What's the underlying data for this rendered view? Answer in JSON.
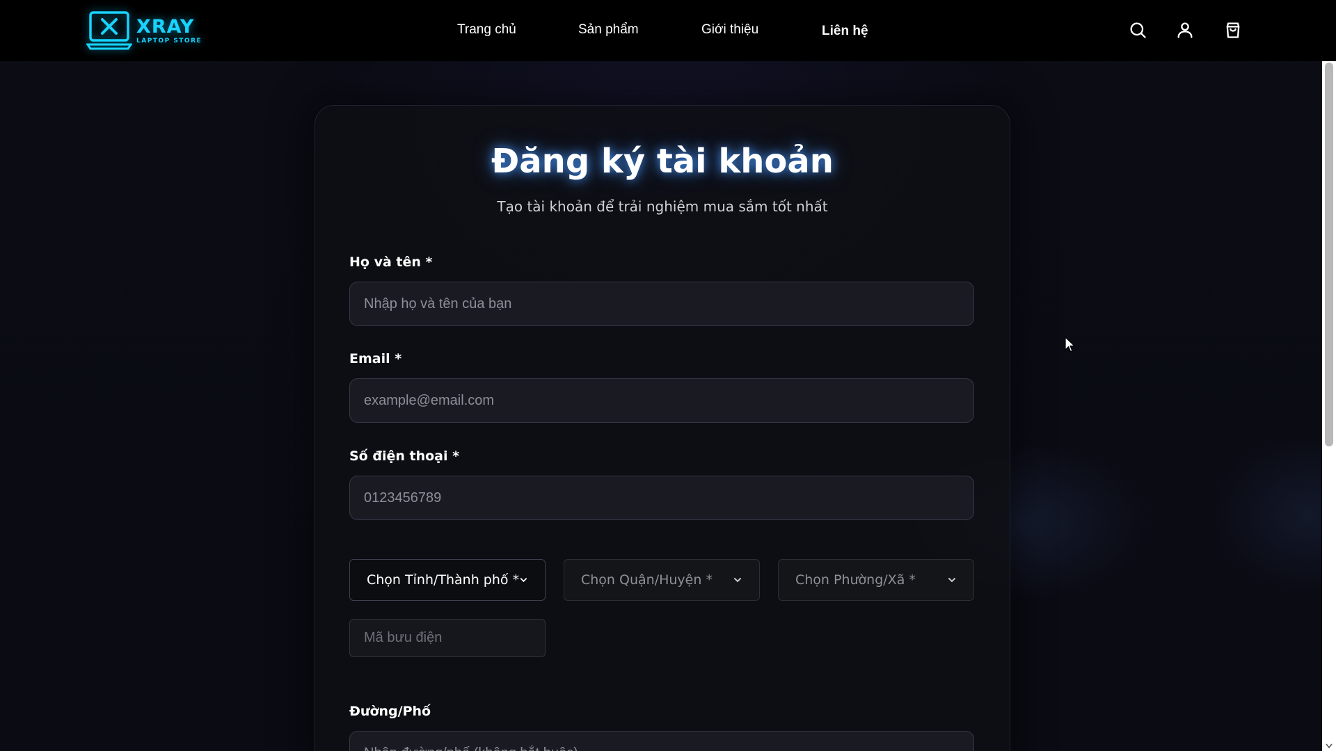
{
  "brand": {
    "name": "XRAY",
    "tagline": "LAPTOP STORE",
    "accent": "#18d4ff"
  },
  "nav": {
    "links": [
      {
        "label": "Trang chủ"
      },
      {
        "label": "Sản phẩm"
      },
      {
        "label": "Giới thiệu"
      },
      {
        "label": "Liên hệ"
      }
    ],
    "icons": [
      "search-icon",
      "user-icon",
      "shopping-bag-icon"
    ]
  },
  "form": {
    "title": "Đăng ký tài khoản",
    "subtitle": "Tạo tài khoản để trải nghiệm mua sắm tốt nhất",
    "full_name": {
      "label": "Họ và tên *",
      "placeholder": "Nhập họ và tên của bạn",
      "value": ""
    },
    "email": {
      "label": "Email *",
      "placeholder": "example@email.com",
      "value": ""
    },
    "phone": {
      "label": "Số điện thoại *",
      "placeholder": "0123456789",
      "value": ""
    },
    "province": {
      "value": "Chọn Tỉnh/Thành phố *",
      "enabled": true
    },
    "district": {
      "value": "Chọn Quận/Huyện *",
      "enabled": false
    },
    "ward": {
      "value": "Chọn Phường/Xã *",
      "enabled": false
    },
    "postal_code": {
      "placeholder": "Mã bưu điện",
      "value": ""
    },
    "street": {
      "label": "Đường/Phố",
      "placeholder": "Nhập đường/phố (không bắt buộc)",
      "value": ""
    }
  },
  "colors": {
    "background": "#0a0b13",
    "navbar": "#000000",
    "card": "#0e0f14",
    "input": "#1a1b22",
    "title_glow": "#4696ff"
  }
}
